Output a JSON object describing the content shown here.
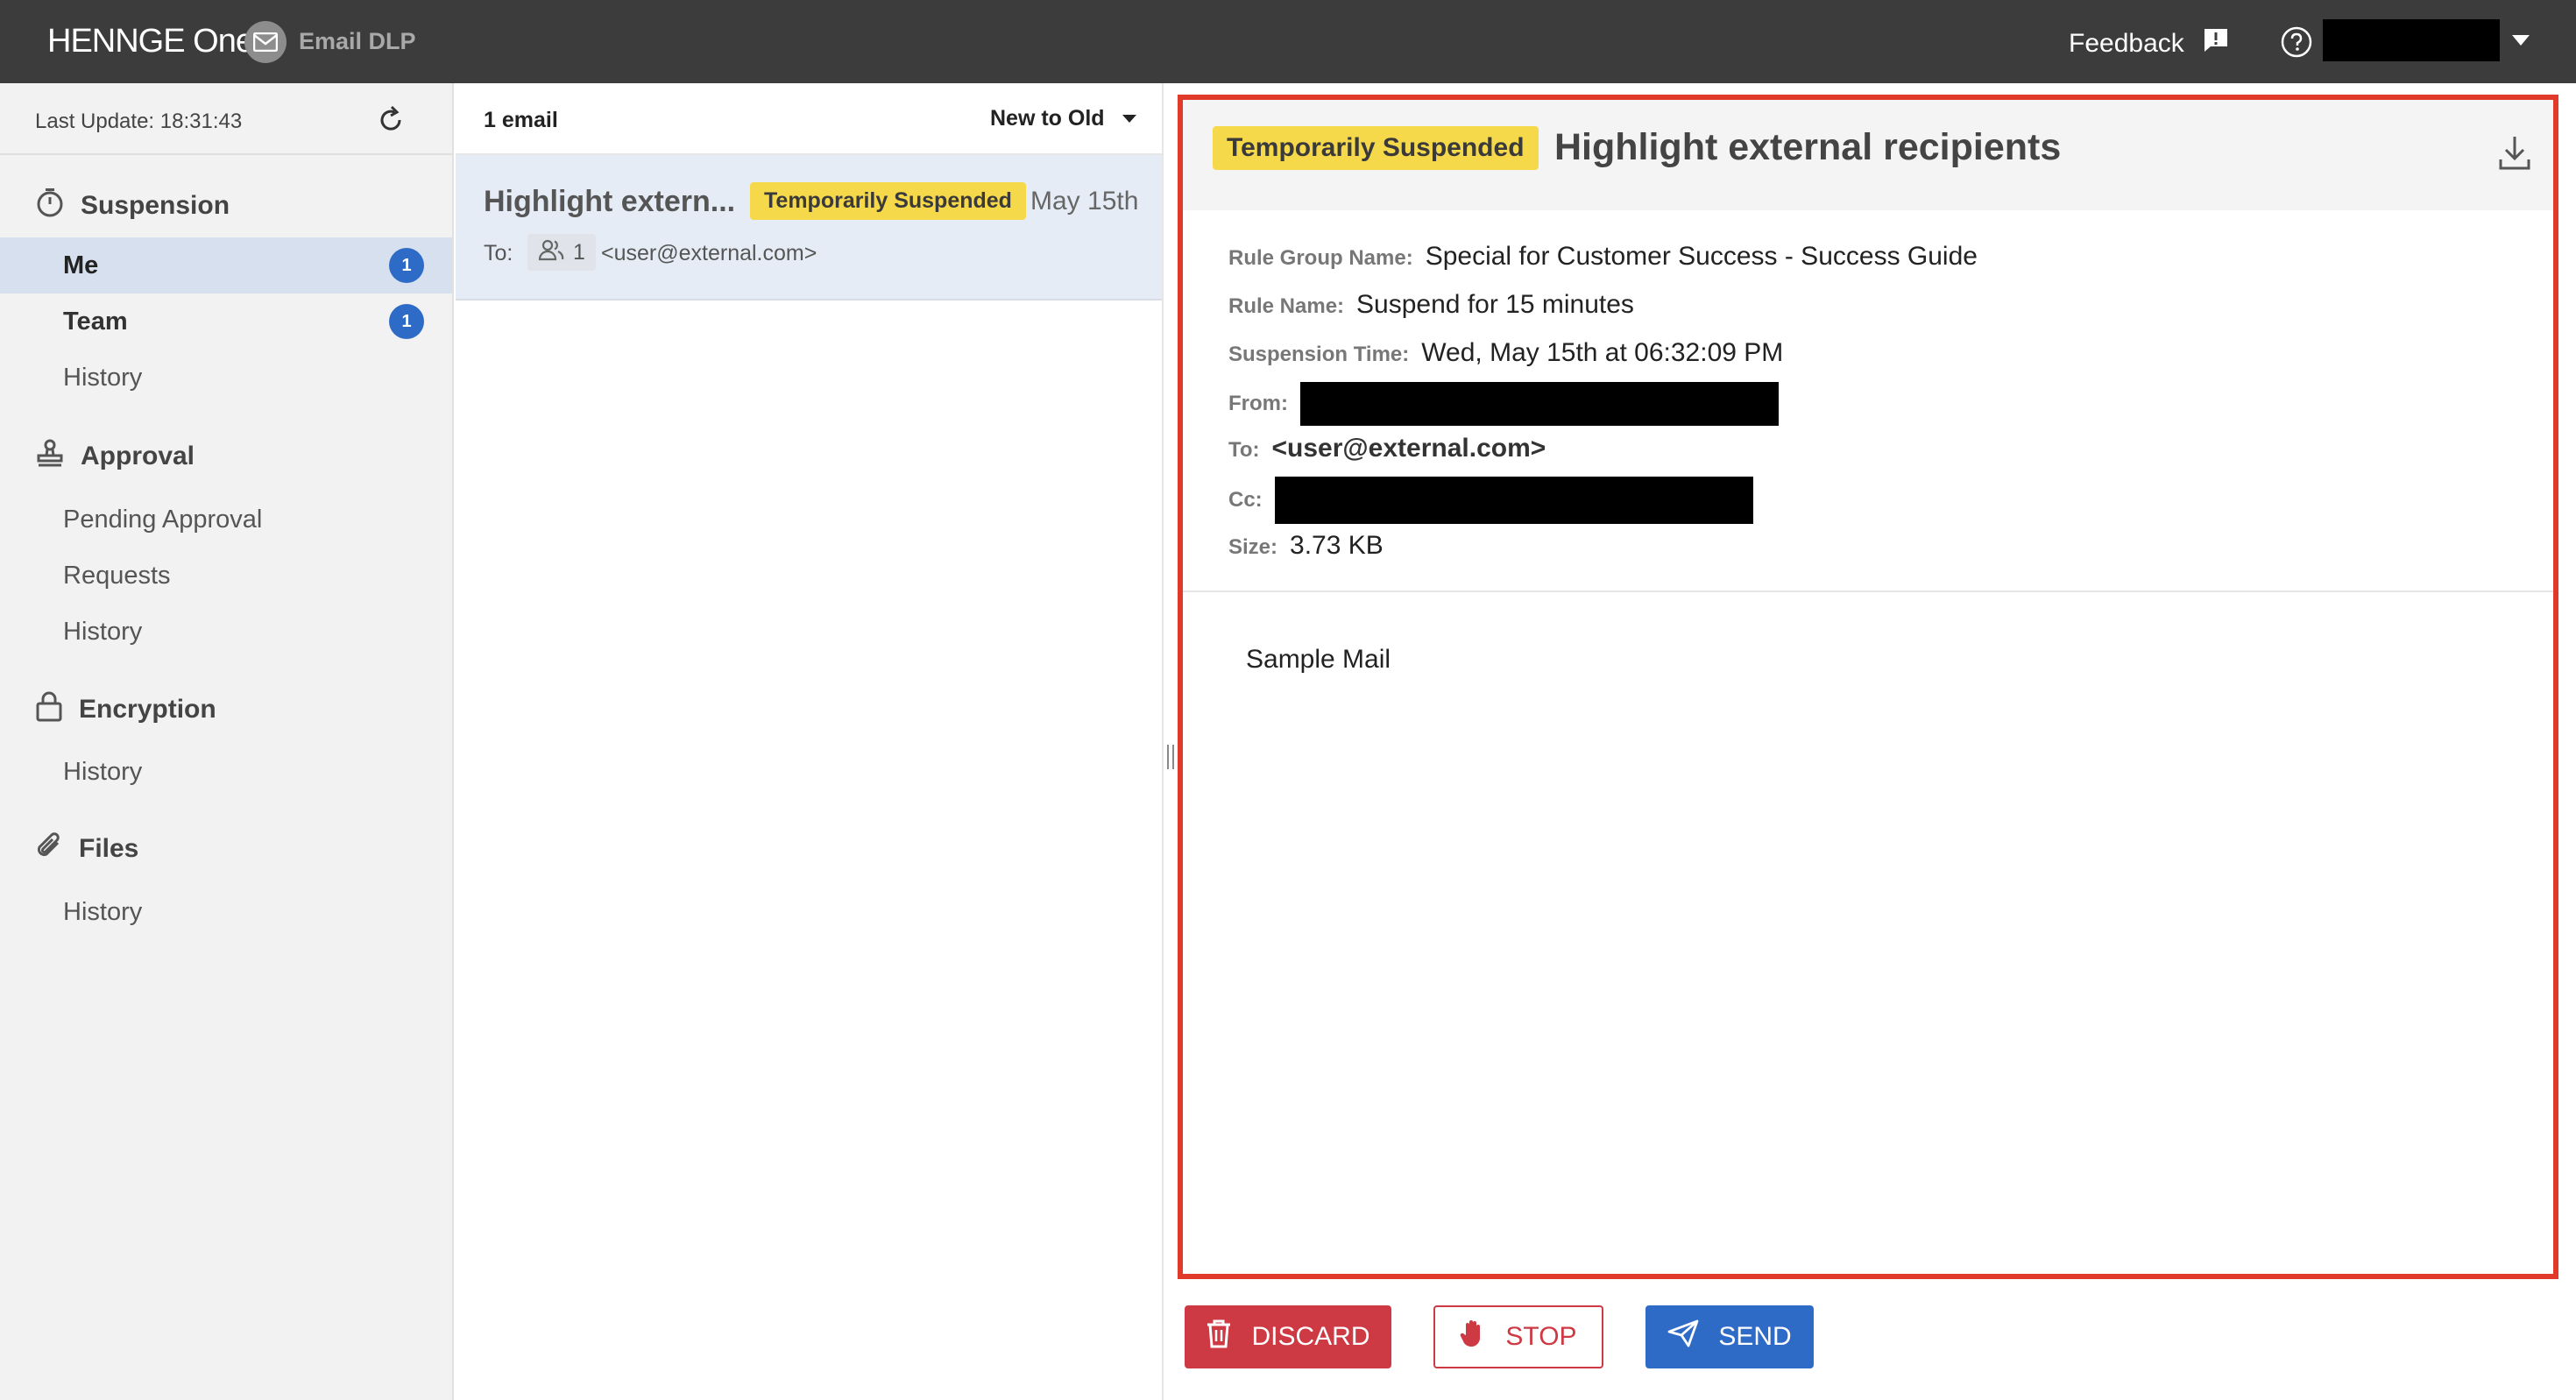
{
  "header": {
    "logo": "HENNGE One",
    "app_name": "Email DLP",
    "feedback_label": "Feedback",
    "icons": [
      "envelope-icon",
      "feedback-icon",
      "help-icon",
      "chevron-down-icon"
    ]
  },
  "sidebar": {
    "last_update": "Last Update: 18:31:43",
    "sections": [
      {
        "title": "Suspension",
        "icon": "timer-icon",
        "items": [
          {
            "label": "Me",
            "count": "1",
            "active": true
          },
          {
            "label": "Team",
            "count": "1"
          },
          {
            "label": "History"
          }
        ]
      },
      {
        "title": "Approval",
        "icon": "stamp-icon",
        "items": [
          {
            "label": "Pending Approval"
          },
          {
            "label": "Requests"
          },
          {
            "label": "History"
          }
        ]
      },
      {
        "title": "Encryption",
        "icon": "lock-icon",
        "items": [
          {
            "label": "History"
          }
        ]
      },
      {
        "title": "Files",
        "icon": "paperclip-icon",
        "items": [
          {
            "label": "History"
          }
        ]
      }
    ]
  },
  "list": {
    "count_label": "1 email",
    "sort_label": "New to Old",
    "emails": [
      {
        "subject": "Highlight extern...",
        "status": "Temporarily Suspended",
        "date": "May 15th",
        "to_label": "To:",
        "recipient_count": "1",
        "to_address": "<user@external.com>"
      }
    ]
  },
  "detail": {
    "status": "Temporarily Suspended",
    "title": "Highlight external recipients",
    "fields": {
      "rule_group_label": "Rule Group Name:",
      "rule_group_value": "Special for Customer Success - Success Guide",
      "rule_name_label": "Rule Name:",
      "rule_name_value": "Suspend for 15 minutes",
      "suspension_time_label": "Suspension Time:",
      "suspension_time_value": "Wed, May 15th at 06:32:09 PM",
      "from_label": "From:",
      "to_label": "To:",
      "to_value": "<user@external.com>",
      "cc_label": "Cc:",
      "size_label": "Size:",
      "size_value": "3.73 KB"
    },
    "body": "Sample Mail"
  },
  "actions": {
    "discard": "DISCARD",
    "stop": "STOP",
    "send": "SEND"
  },
  "colors": {
    "header_bg": "#3c3c3c",
    "badge_yellow": "#f6d94a",
    "highlight_border": "#e03a2a",
    "discard_red": "#cd3a44",
    "send_blue": "#2e6bc7",
    "active_nav": "#d6e0ee"
  }
}
